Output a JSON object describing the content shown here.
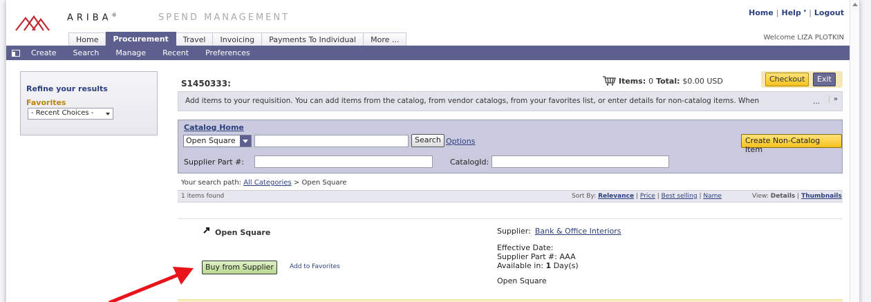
{
  "header": {
    "brand": "ARIBA",
    "brand_mark": "®",
    "product": "SPEND MANAGEMENT",
    "links": {
      "home": "Home",
      "help": "Help",
      "help_caret": "▾",
      "logout": "Logout",
      "separator": "|"
    },
    "welcome": "Welcome LIZA PLOTKIN",
    "colors": {
      "accent": "#5d5f8f",
      "link": "#2b3f7e",
      "logo": "#c1272d"
    }
  },
  "tabs": [
    {
      "label": "Home"
    },
    {
      "label": "Procurement"
    },
    {
      "label": "Travel"
    },
    {
      "label": "Invoicing"
    },
    {
      "label": "Payments To Individual"
    },
    {
      "label": "More ..."
    }
  ],
  "menubar": {
    "icon": "grid-icon",
    "items": [
      "Create",
      "Search",
      "Manage",
      "Recent",
      "Preferences"
    ]
  },
  "sidebar": {
    "title": "Refine your results",
    "favorites_label": "Favorites",
    "favorites_select": "- Recent Choices -"
  },
  "requisition": {
    "id": "S1450333:",
    "items_label": "Items:",
    "items_count": "0",
    "total_label": "Total:",
    "total_value": "$0.00 USD",
    "checkout": "Checkout",
    "exit": "Exit"
  },
  "notice": {
    "text": "Add items to your requisition. You can add items from the catalog, from vendor catalogs, from your favorites list, or enter details for non-catalog items. When",
    "more": "...",
    "expand": "»"
  },
  "catalog": {
    "home_link": "Catalog Home",
    "selected_catalog": "Open Square",
    "search_value": "",
    "search_button": "Search",
    "options_link": "Options",
    "non_catalog_button": "Create Non-Catalog Item",
    "supplier_part_label": "Supplier Part #:",
    "supplier_part_value": "",
    "catalog_id_label": "CatalogId:",
    "catalog_id_value": ""
  },
  "search_path": {
    "label": "Your search path:",
    "all_categories": "All Categories",
    "separator": ">",
    "current": "Open Square"
  },
  "results": {
    "count_text": "1 items found",
    "sort_by_label": "Sort By:",
    "sort_options": [
      "Relevance",
      "Price",
      "Best selling",
      "Name"
    ],
    "sort_separator": "|",
    "view_label": "View:",
    "view_options": [
      "Details",
      "Thumbnails"
    ]
  },
  "item": {
    "name": "Open Square",
    "buy_button": "Buy from Supplier",
    "favorites_link": "Add to Favorites",
    "supplier_label": "Supplier:",
    "supplier_value": "Bank & Office Interiors",
    "effective_date_label": "Effective Date:",
    "supplier_part_label": "Supplier Part #:",
    "supplier_part_value": "AAA",
    "available_label": "Available in:",
    "available_value": "1",
    "available_unit": "Day(s)",
    "description": "Open Square"
  }
}
